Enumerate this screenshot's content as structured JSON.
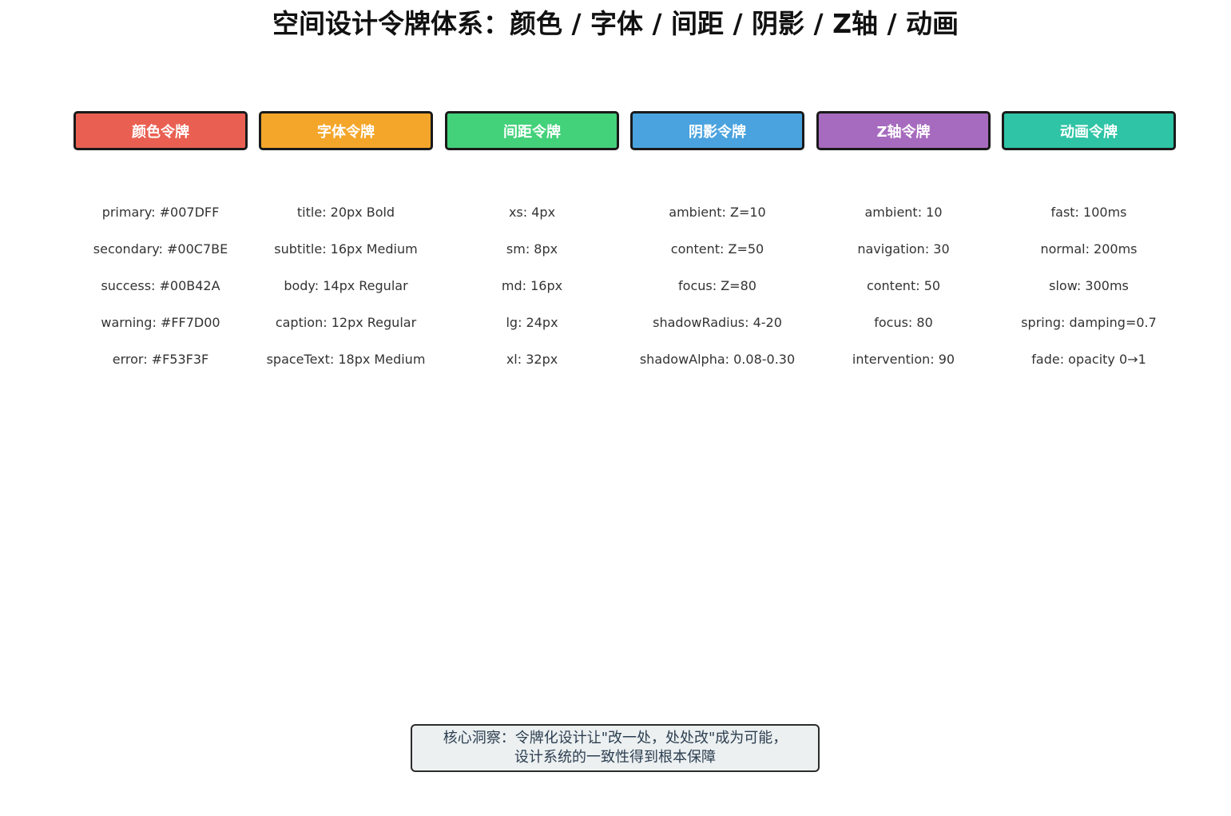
{
  "title": "空间设计令牌体系：颜色 / 字体 / 间距 / 阴影 / Z轴 / 动画",
  "categories": [
    {
      "label": "颜色令牌",
      "color": "#E96052",
      "tokens": [
        "primary: #007DFF",
        "secondary: #00C7BE",
        "success: #00B42A",
        "warning: #FF7D00",
        "error: #F53F3F"
      ]
    },
    {
      "label": "字体令牌",
      "color": "#F4A62A",
      "tokens": [
        "title: 20px Bold",
        "subtitle: 16px Medium",
        "body: 14px Regular",
        "caption: 12px Regular",
        "spaceText: 18px Medium"
      ]
    },
    {
      "label": "间距令牌",
      "color": "#43D17A",
      "tokens": [
        "xs: 4px",
        "sm: 8px",
        "md: 16px",
        "lg: 24px",
        "xl: 32px"
      ]
    },
    {
      "label": "阴影令牌",
      "color": "#4AA3DF",
      "tokens": [
        "ambient: Z=10",
        "content: Z=50",
        "focus: Z=80",
        "shadowRadius: 4-20",
        "shadowAlpha: 0.08-0.30"
      ]
    },
    {
      "label": "Z轴令牌",
      "color": "#A66BBE",
      "tokens": [
        "ambient: 10",
        "navigation: 30",
        "content: 50",
        "focus: 80",
        "intervention: 90"
      ]
    },
    {
      "label": "动画令牌",
      "color": "#2EC4A5",
      "tokens": [
        "fast: 100ms",
        "normal: 200ms",
        "slow: 300ms",
        "spring: damping=0.7",
        "fade: opacity 0→1"
      ]
    }
  ],
  "insight": {
    "line1": "核心洞察：令牌化设计让\"改一处，处处改\"成为可能，",
    "line2": "设计系统的一致性得到根本保障"
  }
}
